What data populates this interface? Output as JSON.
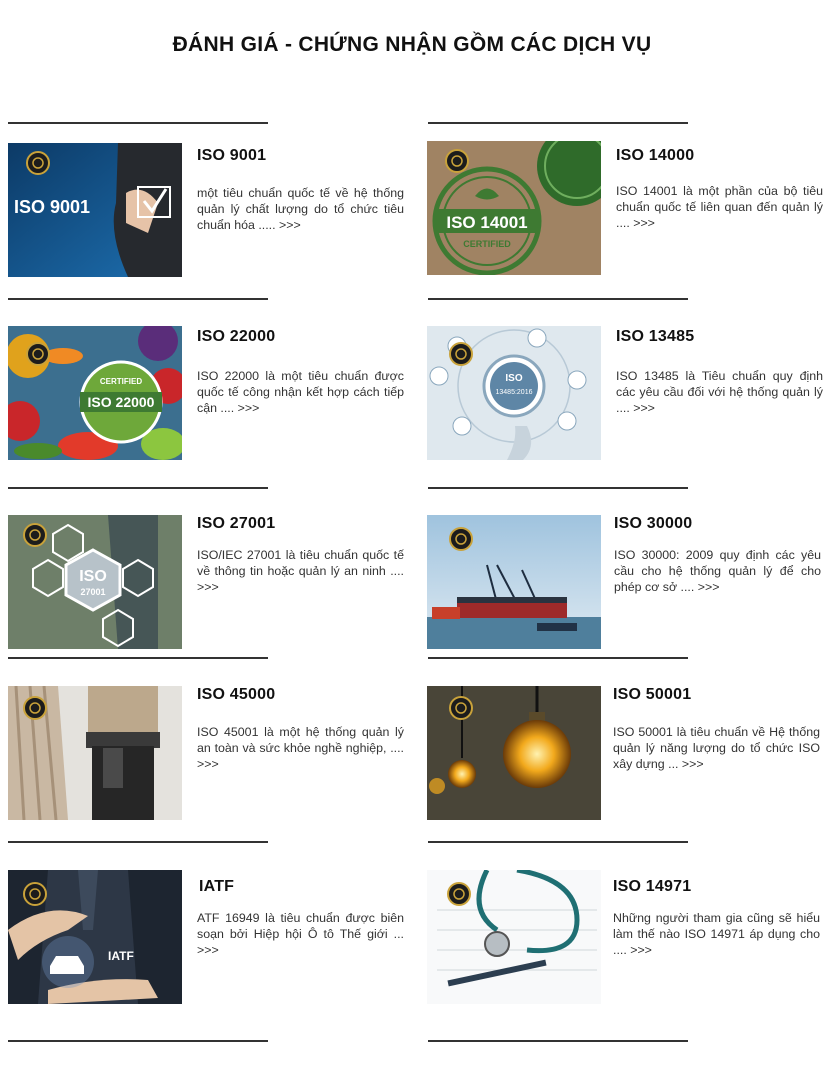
{
  "page": {
    "title": "ĐÁNH GIÁ - CHỨNG NHẬN GỒM CÁC DỊCH VỤ"
  },
  "colors": {
    "accent_gold": "#c9a23a",
    "text": "#333333",
    "divider": "#333333"
  },
  "services": [
    {
      "title": "ISO 9001",
      "description": "một tiêu chuẩn quốc tế về hệ thống quản lý chất lượng do tổ chức tiêu chuẩn hóa ..... >>>",
      "image_text": "ISO 9001"
    },
    {
      "title": "ISO 14000",
      "description": "ISO 14001 là một phần của bộ tiêu chuẩn quốc tế liên quan đến quản lý .... >>>",
      "image_text": "ISO 14001",
      "image_subtext": "CERTIFIED"
    },
    {
      "title": "ISO 22000",
      "description": "ISO 22000 là một tiêu chuẩn được quốc tế công nhận kết hợp cách tiếp cận .... >>>",
      "image_text": "ISO 22000",
      "image_subtext": "CERTIFIED"
    },
    {
      "title": "ISO 13485",
      "description": "ISO 13485 là Tiêu chuẩn quy định các yêu cầu đối với hệ thống quản lý  .... >>>",
      "image_text": "ISO",
      "image_subtext": "13485:2016"
    },
    {
      "title": "ISO 27001",
      "description": "ISO/IEC 27001 là tiêu chuẩn quốc tế về thông tin hoặc quản lý an ninh .... >>>",
      "image_text": "ISO",
      "image_subtext": "27001"
    },
    {
      "title": "ISO 30000",
      "description": "ISO 30000: 2009 quy định các yêu cầu cho hệ thống quản lý để cho phép cơ sở .... >>>"
    },
    {
      "title": "ISO 45000",
      "description": "ISO 45001 là một hệ thống quản lý an toàn và sức khỏe nghề nghiệp,  .... >>>"
    },
    {
      "title": "ISO 50001",
      "description": "ISO 50001 là tiêu chuẩn về Hệ thống quản lý năng lượng do tổ chức ISO xây dựng ...  >>>"
    },
    {
      "title": "IATF",
      "description": "ATF 16949 là tiêu chuẩn được biên soạn bởi Hiệp hội Ô tô Thế giới ... >>>",
      "image_text": "IATF"
    },
    {
      "title": "ISO 14971",
      "description": "Những người tham gia cũng sẽ hiểu làm thế nào ISO 14971 áp dụng cho  .... >>>"
    }
  ]
}
